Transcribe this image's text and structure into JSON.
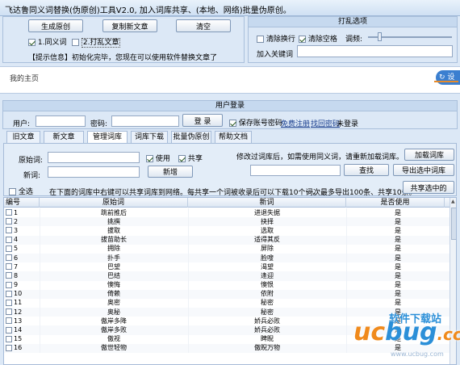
{
  "window": {
    "title": "飞达鲁同义词替换(伪原创)工具V2.0, 加入词库共享、(本地、网络)批量伪原创。"
  },
  "top": {
    "btn_generate": "生成原创",
    "btn_copy": "复制新文章",
    "btn_clear": "清空",
    "opt1_label": "1.同义词",
    "opt2_label": "2.打乱文章",
    "info": "【提示信息】初始化完毕，您现在可以使用软件替换文章了"
  },
  "shuffle": {
    "title": "打乱选项",
    "clear_newline": "清除换行",
    "clear_space": "清除空格",
    "degree": "调频:",
    "keyword_label": "加入关键词"
  },
  "homepage": {
    "label": "我的主页",
    "setting_btn": "设"
  },
  "login": {
    "title": "用户登录",
    "user_label": "用户:",
    "pwd_label": "密码:",
    "login_btn": "登 录",
    "save_pwd": "保存账号密码",
    "free_register": "免费注册",
    "forgot_pwd": "找回密码",
    "status": "未登录"
  },
  "tabs": [
    "旧文章",
    "新文章",
    "管理词库",
    "词库下载",
    "批量伪原创",
    "帮助文档"
  ],
  "manage": {
    "orig_label": "原始词:",
    "new_label": "新词:",
    "use_label": "使用",
    "share_label": "共享",
    "add_btn": "新增",
    "hint": "修改过词库后，如需使用同义词，请重新加载词库。",
    "load_btn": "加载词库",
    "search_btn": "查找",
    "export_btn": "导出选中词库",
    "select_all": "全选",
    "upload_hint": "在下面的词库中右键可以共享词库到网络。每共享一个词被收录后可以下载10个词。",
    "limit_hint": "一次最多导出100条、共享10条。",
    "share_btn": "共享选中的"
  },
  "grid": {
    "headers": [
      "编号",
      "原始词",
      "新词",
      "是否使用"
    ],
    "rows": [
      [
        "1",
        "跳前推后",
        "进退失据",
        "是"
      ],
      [
        "2",
        "挑撰",
        "抉择",
        "是"
      ],
      [
        "3",
        "拔取",
        "选取",
        "是"
      ],
      [
        "4",
        "拔苗助长",
        "适得其反",
        "是"
      ],
      [
        "5",
        "拥除",
        "屏除",
        "是"
      ],
      [
        "6",
        "扑手",
        "脸嗖",
        "是"
      ],
      [
        "7",
        "巴望",
        "渴望",
        "是"
      ],
      [
        "8",
        "巴结",
        "逢迎",
        "是"
      ],
      [
        "9",
        "懊悔",
        "懊恨",
        "是"
      ],
      [
        "10",
        "倚赖",
        "依附",
        "是"
      ],
      [
        "11",
        "奥密",
        "秘密",
        "是"
      ],
      [
        "12",
        "奥秘",
        "秘密",
        "是"
      ],
      [
        "13",
        "傲岸多降",
        "娇兵必败",
        "是"
      ],
      [
        "14",
        "傲岸多败",
        "娇兵必败",
        "是"
      ],
      [
        "15",
        "傲视",
        "睥睨",
        "是"
      ],
      [
        "16",
        "傲世轻物",
        "傲睨万物",
        "是"
      ]
    ]
  },
  "watermark": {
    "cn": "软件下载站",
    "brand1": "uc",
    "brand2": "bug",
    "tld": ".cc",
    "url": "www.ucbug.com"
  },
  "colors": {
    "accent": "#2f6fc7",
    "link": "#1a3f8f",
    "brand_orange": "#f08a1c",
    "brand_blue": "#2b8fd8"
  }
}
